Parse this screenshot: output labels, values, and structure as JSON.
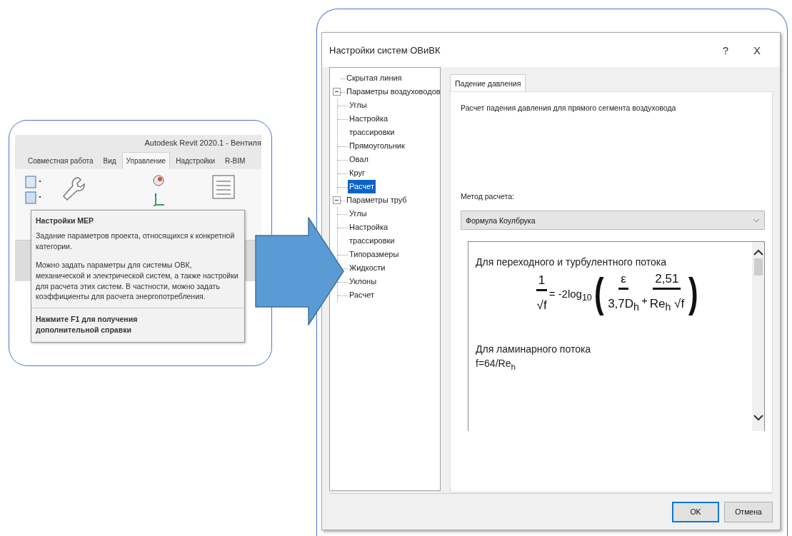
{
  "left_screenshot": {
    "title": "Autodesk Revit 2020.1 - Вентиля",
    "tabs": [
      {
        "label": "Совместная работа",
        "selected": false
      },
      {
        "label": "Вид",
        "selected": false
      },
      {
        "label": "Управление",
        "selected": true
      },
      {
        "label": "Надстройки",
        "selected": false
      },
      {
        "label": "R-BIM",
        "selected": false
      }
    ],
    "tooltip": {
      "title": "Настройки MEP",
      "paragraphs": [
        "Задание параметров проекта, относящихся к конкретной категории.",
        "Можно задать параметры для системы ОВК, механической и электрической систем, а также настройки для расчета этих систем. В частности, можно задать коэффициенты для расчета энергопотребления."
      ],
      "footer": "Нажмите F1 для получения дополнительной справки"
    }
  },
  "dialog": {
    "title": "Настройки систем ОВиВК",
    "help_button": "?",
    "close_button": "X",
    "tree": [
      {
        "label": "Скрытая линия",
        "selected": false
      },
      {
        "label": "Параметры воздуховодов",
        "selected": false,
        "expanded": true,
        "children": [
          {
            "label": "Углы",
            "selected": false
          },
          {
            "label": "Настройка трассировки",
            "selected": false
          },
          {
            "label": "Прямоугольник",
            "selected": false
          },
          {
            "label": "Овал",
            "selected": false
          },
          {
            "label": "Круг",
            "selected": false
          },
          {
            "label": "Расчет",
            "selected": true
          }
        ]
      },
      {
        "label": "Параметры труб",
        "selected": false,
        "expanded": true,
        "children": [
          {
            "label": "Углы",
            "selected": false
          },
          {
            "label": "Настройка трассировки",
            "selected": false
          },
          {
            "label": "Типоразмеры",
            "selected": false
          },
          {
            "label": "Жидкости",
            "selected": false
          },
          {
            "label": "Уклоны",
            "selected": false
          },
          {
            "label": "Расчет",
            "selected": false
          }
        ]
      }
    ],
    "tabs": [
      {
        "label": "Падение давления",
        "selected": true
      }
    ],
    "description": "Расчет падения давления для прямого сегмента воздуховода",
    "method_label": "Метод расчета:",
    "method_select": {
      "value": "Формула Коулбрука"
    },
    "formula_panel": {
      "turbulent_heading": "Для переходного и турбулентного потока",
      "formula": {
        "lhs_numerator": "1",
        "lhs_denominator": "√f",
        "operator": "= -2log$_{10}$",
        "open_paren": "(",
        "term1_numerator": "ε",
        "term1_denominator": "3,7D$_{h}$",
        "plus": "+",
        "term2_numerator": "2,51",
        "term2_denominator": "Re$_{h}$ √f",
        "close_paren": ")"
      },
      "laminar_heading": "Для ламинарного потока",
      "laminar_formula": "f=64/Re$_{h}$"
    },
    "buttons": [
      {
        "label": "OK",
        "default": true
      },
      {
        "label": "Отмена",
        "default": false
      }
    ]
  }
}
